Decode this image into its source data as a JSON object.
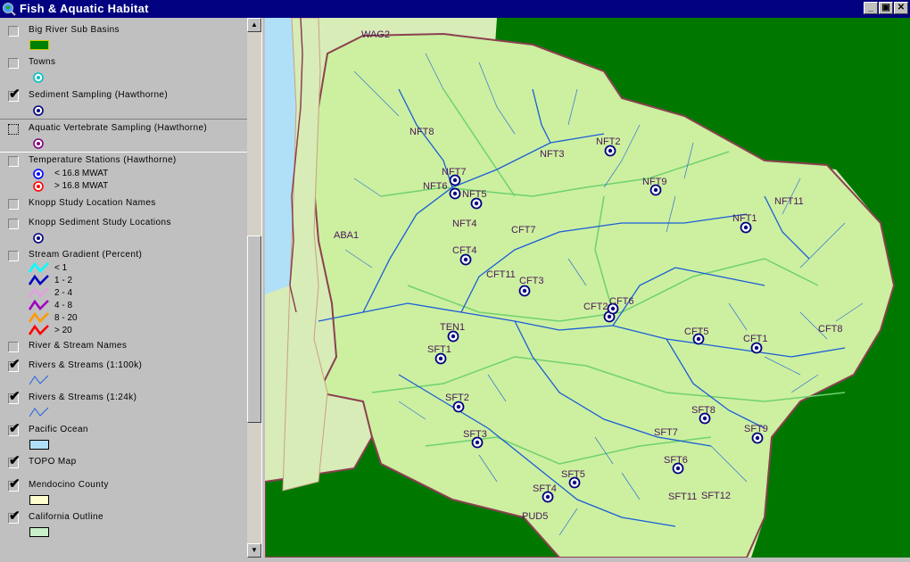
{
  "window": {
    "title": "Fish & Aquatic Habitat",
    "buttons": [
      "_",
      "▣",
      "✕"
    ]
  },
  "toc": {
    "layers": [
      {
        "id": "big-river-sub-basins",
        "label": "Big River Sub Basins",
        "checked": false,
        "legend": [
          {
            "kind": "fill",
            "color": "#008000",
            "border": "#c8c800"
          }
        ]
      },
      {
        "id": "towns",
        "label": "Towns",
        "checked": false,
        "legend": [
          {
            "kind": "point",
            "color": "#00c0c0"
          }
        ]
      },
      {
        "id": "sediment-sampling",
        "label": "Sediment Sampling (Hawthorne)",
        "checked": true,
        "legend": [
          {
            "kind": "point",
            "color": "#000080"
          }
        ]
      },
      {
        "id": "aquatic-vertebrate-sampling",
        "label": "Aquatic Vertebrate Sampling (Hawthorne)",
        "checked": false,
        "active": true,
        "legend": [
          {
            "kind": "point",
            "color": "#800080"
          }
        ]
      },
      {
        "id": "temperature-stations",
        "label": "Temperature Stations (Hawthorne)",
        "checked": false,
        "legend": [
          {
            "kind": "point",
            "color": "#0000ff",
            "text": "< 16.8 MWAT"
          },
          {
            "kind": "point",
            "color": "#ff0000",
            "text": "> 16.8 MWAT"
          }
        ]
      },
      {
        "id": "knopp-study-location-names",
        "label": "Knopp Study Location Names",
        "checked": false,
        "legend": []
      },
      {
        "id": "knopp-sediment-study-locations",
        "label": "Knopp Sediment Study Locations",
        "checked": false,
        "legend": [
          {
            "kind": "point",
            "color": "#000080"
          }
        ]
      },
      {
        "id": "stream-gradient",
        "label": "Stream Gradient (Percent)",
        "checked": false,
        "legend": [
          {
            "kind": "line",
            "color": "#00ffff",
            "text": "< 1"
          },
          {
            "kind": "line",
            "color": "#0000c0",
            "text": "1 - 2"
          },
          {
            "kind": "line",
            "color": "#e0a0e0",
            "text": "2 - 4"
          },
          {
            "kind": "line",
            "color": "#a000c0",
            "text": "4 - 8"
          },
          {
            "kind": "line",
            "color": "#ff9900",
            "text": "8 - 20"
          },
          {
            "kind": "line",
            "color": "#ff0000",
            "text": "> 20"
          }
        ]
      },
      {
        "id": "river-stream-names",
        "label": "River & Stream Names",
        "checked": false,
        "legend": []
      },
      {
        "id": "rivers-streams-100k",
        "label": "Rivers & Streams (1:100k)",
        "checked": true,
        "legend": [
          {
            "kind": "thinline",
            "color": "#2060e0"
          }
        ]
      },
      {
        "id": "rivers-streams-24k",
        "label": "Rivers & Streams (1:24k)",
        "checked": true,
        "legend": [
          {
            "kind": "thinline",
            "color": "#2060e0"
          }
        ]
      },
      {
        "id": "pacific-ocean",
        "label": "Pacific Ocean",
        "checked": true,
        "legend": [
          {
            "kind": "fill",
            "color": "#b0e0f8",
            "border": "#000000"
          }
        ]
      },
      {
        "id": "topo-map",
        "label": "TOPO Map",
        "checked": true,
        "legend": []
      },
      {
        "id": "mendocino-county",
        "label": "Mendocino County",
        "checked": true,
        "legend": [
          {
            "kind": "fill",
            "color": "#ffffd0",
            "border": "#000000"
          }
        ]
      },
      {
        "id": "california-outline",
        "label": "California Outline",
        "checked": true,
        "legend": [
          {
            "kind": "fill",
            "color": "#c8f0c8",
            "border": "#000000"
          }
        ]
      }
    ]
  },
  "map": {
    "colors": {
      "ocean": "#b0e0f8",
      "land": "#d8ecb8",
      "basin": "#ccf0a0",
      "outside": "#007800",
      "boundary": "#8b4050",
      "river": "#1c5cd8",
      "subbasin": "#70d070"
    },
    "stations": [
      "NFT2",
      "NFT3",
      "NFT9",
      "NFT7",
      "NFT6",
      "NFT5",
      "NFT4",
      "NFT1",
      "CFT4",
      "CFT11",
      "CFT3",
      "CFT2",
      "CFT6",
      "CFT5",
      "CFT1",
      "TEN1",
      "SFT1",
      "SFT2",
      "SFT3",
      "SFT8",
      "SFT9",
      "SFT6",
      "SFT5",
      "SFT4"
    ],
    "labels": [
      "WAG2",
      "NFT8",
      "NFT2",
      "NFT3",
      "NFT7",
      "NFT6",
      "NFT5",
      "NFT9",
      "NFT11",
      "NFT4",
      "NFT1",
      "ABA1",
      "CFT7",
      "CFT4",
      "CFT11",
      "CFT3",
      "CFT6",
      "CFT2",
      "TEN1",
      "CFT5",
      "CFT1",
      "CFT8",
      "SFT1",
      "SFT2",
      "SFT8",
      "SFT3",
      "SFT9",
      "SFT7",
      "SFT6",
      "SFT5",
      "SFT4",
      "SFT11",
      "SFT12",
      "PUD5"
    ]
  }
}
